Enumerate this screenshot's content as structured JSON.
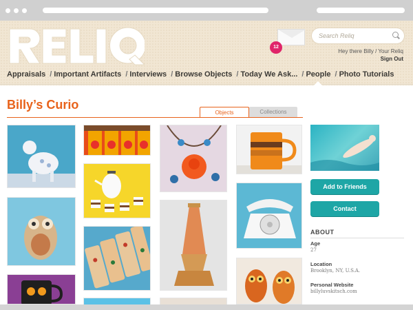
{
  "logo_text": "RELIQ",
  "header": {
    "search_placeholder": "Search Reliq",
    "notifications_count": "12",
    "greeting": "Hey there Billy / Your Reliq",
    "sign_out": "Sign Out"
  },
  "nav": {
    "items": [
      "Appraisals",
      "Important Artifacts",
      "Interviews",
      "Browse Objects",
      "Today We Ask...",
      "People",
      "Photo Tutorials"
    ],
    "separator": "/"
  },
  "page_title": "Billy’s Curio",
  "tabs": {
    "objects": "Objects",
    "collections": "Collections"
  },
  "sidebar": {
    "add_friends": "Add to Friends",
    "contact": "Contact",
    "about_heading": "ABOUT",
    "age_label": "Age",
    "age_value": "27",
    "location_label": "Location",
    "location_value": "Brooklyn, NY, U.S.A.",
    "website_label": "Personal Website",
    "website_value": "billyluvskitsch.com"
  },
  "photos": [
    {
      "name": "photo-lamb-figurine",
      "color": "#4aa7c9"
    },
    {
      "name": "photo-orange-canisters",
      "color": "#e84c1a"
    },
    {
      "name": "photo-necklace",
      "color": "#e5d8e2"
    },
    {
      "name": "photo-striped-mug",
      "color": "#f2f2f2"
    },
    {
      "name": "photo-tea-set",
      "color": "#f6d62a"
    },
    {
      "name": "photo-owl-figurine",
      "color": "#7fc7e0"
    },
    {
      "name": "photo-lava-lamp",
      "color": "#e4e4e4"
    },
    {
      "name": "photo-rotary-phone",
      "color": "#5cb8d4"
    },
    {
      "name": "photo-floral-trays",
      "color": "#56a9cc"
    },
    {
      "name": "photo-owl-mug",
      "color": "#8a3f94"
    },
    {
      "name": "photo-owl-pair",
      "color": "#f1e9df"
    }
  ],
  "colors": {
    "accent": "#e8621a",
    "button": "#1ea6a6",
    "badge": "#e0256a"
  }
}
